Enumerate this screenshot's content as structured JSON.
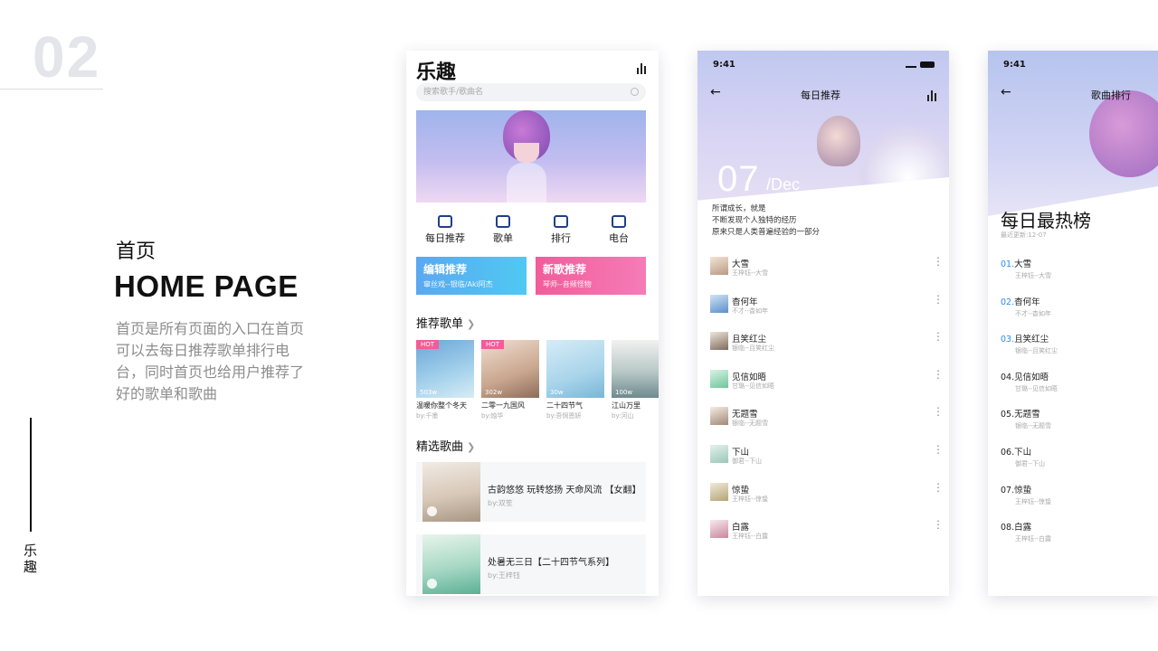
{
  "slide": {
    "page_number": "02",
    "section_title_cn": "首页",
    "section_title_en": "HOME PAGE",
    "description": "首页是所有页面的入口在首页可以去每日推荐歌单排行电台，同时首页也给用户推荐了好的歌单和歌曲",
    "brand_vertical": "乐趣"
  },
  "home": {
    "app_title": "乐趣",
    "search_placeholder": "搜索歌手/歌曲名",
    "categories": [
      {
        "label": "每日推荐",
        "icon": "calendar-icon"
      },
      {
        "label": "歌单",
        "icon": "playlist-icon"
      },
      {
        "label": "排行",
        "icon": "bookmark-icon"
      },
      {
        "label": "电台",
        "icon": "radio-icon"
      }
    ],
    "features": [
      {
        "title": "编辑推荐",
        "subtitle": "窜丝戏--银临/Aki阿杰",
        "color": "#4fb3f2"
      },
      {
        "title": "新歌推荐",
        "subtitle": "琴师--音频怪物",
        "color": "#f25c9a"
      }
    ],
    "playlists_heading": "推荐歌单",
    "playlists": [
      {
        "badge": "HOT",
        "plays": "503w",
        "title": "温暖你整个冬天",
        "author": "by:千墨"
      },
      {
        "badge": "HOT",
        "plays": "302w",
        "title": "二零一九国风",
        "author": "by:烛华"
      },
      {
        "badge": "",
        "plays": "30w",
        "title": "二十四节气",
        "author": "by:吾悯恩妍"
      },
      {
        "badge": "",
        "plays": "100w",
        "title": "江山万里",
        "author": "by:河山"
      }
    ],
    "songs_heading": "精选歌曲",
    "songs": [
      {
        "title": "古韵悠悠 玩转悠扬 天命风流 【女翻】",
        "author": "by:双笙"
      },
      {
        "title": "处暑无三日【二十四节气系列】",
        "author": "by:王梓钰"
      }
    ]
  },
  "daily": {
    "time": "9:41",
    "nav_title": "每日推荐",
    "day": "07",
    "month": "/Dec",
    "quote": [
      "所谓成长，就是",
      "不断发现个人独特的经历",
      "原来只是人类普遍经验的一部分"
    ],
    "songs": [
      {
        "title": "大雪",
        "artist": "王梓钰--大雪"
      },
      {
        "title": "杳何年",
        "artist": "不才--杳如年"
      },
      {
        "title": "且笑红尘",
        "artist": "银临--且笑红尘"
      },
      {
        "title": "见信如晤",
        "artist": "甘璐--见信如晤"
      },
      {
        "title": "无题雪",
        "artist": "银临--无题雪"
      },
      {
        "title": "下山",
        "artist": "御君--下山"
      },
      {
        "title": "惊蛰",
        "artist": "王梓钰--惊蛰"
      },
      {
        "title": "白露",
        "artist": "王梓钰--白露"
      }
    ]
  },
  "ranking": {
    "time": "9:41",
    "nav_title": "歌曲排行",
    "title": "每日最热榜",
    "updated": "最近更新:12-07",
    "songs": [
      {
        "rank": "01.",
        "title": "大雪",
        "artist": "王梓钰--大雪"
      },
      {
        "rank": "02.",
        "title": "杳何年",
        "artist": "不才--杳如年"
      },
      {
        "rank": "03.",
        "title": "且笑红尘",
        "artist": "银临--且笑红尘"
      },
      {
        "rank": "04.",
        "title": "见信如晤",
        "artist": "甘璐--见信如晤"
      },
      {
        "rank": "05.",
        "title": "无题雪",
        "artist": "银临--无题雪"
      },
      {
        "rank": "06.",
        "title": "下山",
        "artist": "御君--下山"
      },
      {
        "rank": "07.",
        "title": "惊蛰",
        "artist": "王梓钰--惊蛰"
      },
      {
        "rank": "08.",
        "title": "白露",
        "artist": "王梓钰--白露"
      }
    ]
  }
}
